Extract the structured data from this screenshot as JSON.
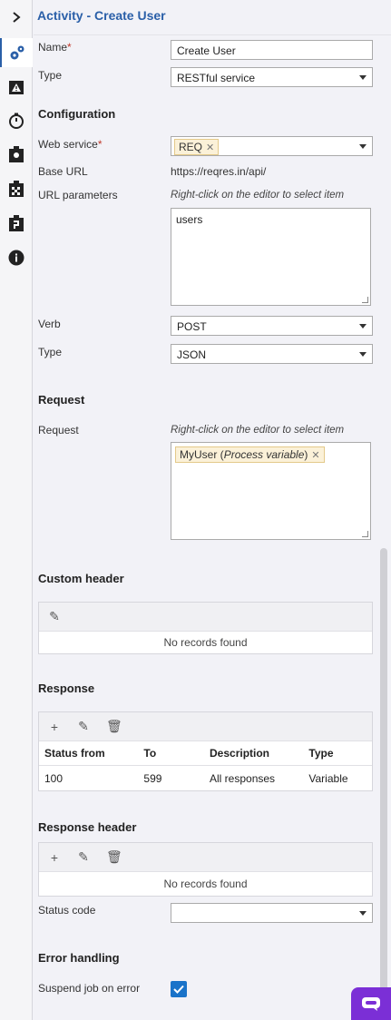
{
  "title": "Activity  - Create User",
  "fields": {
    "name_label": "Name",
    "name_value": "Create User",
    "type_label": "Type",
    "type_value": "RESTful service",
    "required_mark": "*"
  },
  "configuration": {
    "heading": "Configuration",
    "web_service_label": "Web service",
    "web_service_chip": "REQ",
    "base_url_label": "Base URL",
    "base_url_value": "https://reqres.in/api/",
    "url_params_label": "URL parameters",
    "url_params_hint": "Right-click on the editor to select item",
    "url_params_value": "users",
    "verb_label": "Verb",
    "verb_value": "POST",
    "type_label": "Type",
    "type_value": "JSON"
  },
  "request": {
    "heading": "Request",
    "label": "Request",
    "hint": "Right-click on the editor to select item",
    "chip_name": "MyUser",
    "chip_kind": "Process variable"
  },
  "custom_header": {
    "heading": "Custom header",
    "empty": "No records found"
  },
  "response": {
    "heading": "Response",
    "columns": [
      "Status from",
      "To",
      "Description",
      "Type"
    ],
    "rows": [
      [
        "100",
        "599",
        "All responses",
        "Variable"
      ]
    ]
  },
  "response_header": {
    "heading": "Response header",
    "empty": "No records found",
    "status_code_label": "Status code",
    "status_code_value": ""
  },
  "error_handling": {
    "heading": "Error handling",
    "suspend_label": "Suspend job on error",
    "suspend_checked": true
  },
  "icons": [
    "chevron-right-icon",
    "settings-icon",
    "warning-icon",
    "timer-icon",
    "location-icon",
    "checkered-flag-icon",
    "clipboard-icon",
    "info-icon",
    "pencil-icon",
    "plus-icon",
    "trash-icon",
    "chat-icon"
  ],
  "colors": {
    "accent": "#2a5fa8",
    "chip_bg": "#fbf1d8",
    "checkbox": "#1a73c9",
    "chat": "#7b2fd6",
    "required": "#c0392b"
  }
}
